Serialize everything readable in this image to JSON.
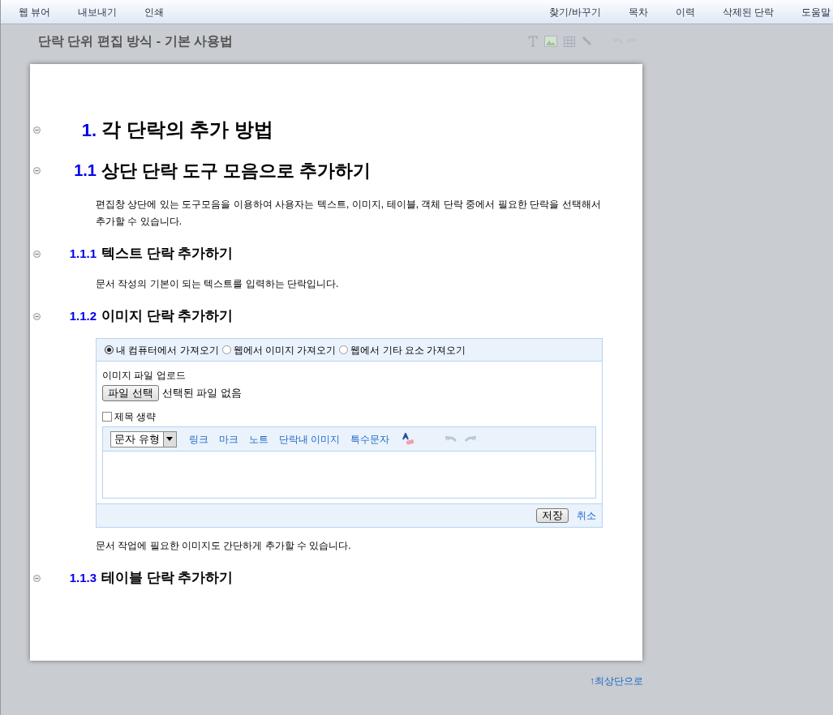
{
  "menu_left": [
    "웹 뷰어",
    "내보내기",
    "인쇄"
  ],
  "menu_right": [
    "찾기/바꾸기",
    "목차",
    "이력",
    "삭제된 단락",
    "도움말"
  ],
  "doc_title": "단락 단위 편집 방식 - 기본 사용법",
  "sections": [
    {
      "kind": "h1",
      "number": "1.",
      "title": "각 단락의 추가 방법"
    },
    {
      "kind": "h2",
      "number": "1.1",
      "title": "상단 단락 도구 모음으로 추가하기",
      "paragraph": "편집창 상단에 있는 도구모음을 이용하여 사용자는 텍스트, 이미지, 테이블, 객체 단락 중에서 필요한 단락을 선택해서 추가할 수 있습니다."
    },
    {
      "kind": "h3",
      "number": "1.1.1",
      "title": "텍스트 단락 추가하기",
      "paragraph": "문서 작성의 기본이 되는 텍스트를 입력하는 단락입니다."
    },
    {
      "kind": "h3",
      "number": "1.1.2",
      "title": "이미지 단락 추가하기",
      "image_editor": {
        "sources": [
          {
            "label": "내 컴퓨터에서 가져오기",
            "selected": true
          },
          {
            "label": "웹에서 이미지 가져오기",
            "selected": false
          },
          {
            "label": "웹에서 기타 요소 가져오기",
            "selected": false
          }
        ],
        "upload_label": "이미지 파일 업로드",
        "file_button": "파일 선택",
        "file_status": "선택된 파일 없음",
        "omit_caption": {
          "label": "제목 생략",
          "checked": false
        },
        "style_select": "문자 유형",
        "tools": [
          "링크",
          "마크",
          "노트",
          "단락내 이미지",
          "특수문자"
        ],
        "save": "저장",
        "cancel": "취소"
      },
      "paragraph": "문서 작업에 필요한 이미지도 간단하게 추가할 수 있습니다."
    },
    {
      "kind": "h3",
      "number": "1.1.3",
      "title": "테이블 단락 추가하기"
    }
  ],
  "back_to_top": "↑최상단으로"
}
